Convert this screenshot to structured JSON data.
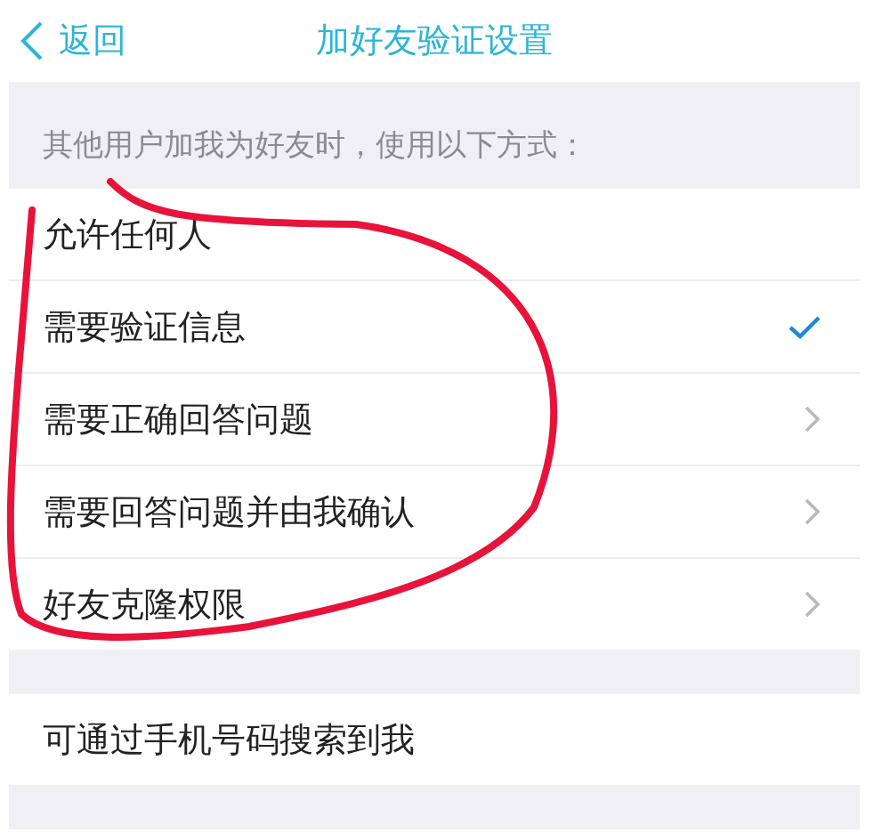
{
  "nav": {
    "back": "返回",
    "title": "加好友验证设置"
  },
  "section_header": "其他用户加我为好友时，使用以下方式：",
  "options": [
    {
      "label": "允许任何人",
      "kind": "choice",
      "selected": false
    },
    {
      "label": "需要验证信息",
      "kind": "choice",
      "selected": true
    },
    {
      "label": "需要正确回答问题",
      "kind": "link",
      "selected": false
    },
    {
      "label": "需要回答问题并由我确认",
      "kind": "link",
      "selected": false
    },
    {
      "label": "好友克隆权限",
      "kind": "link",
      "selected": false
    }
  ],
  "second_section": [
    {
      "label": "可通过手机号码搜索到我"
    }
  ]
}
